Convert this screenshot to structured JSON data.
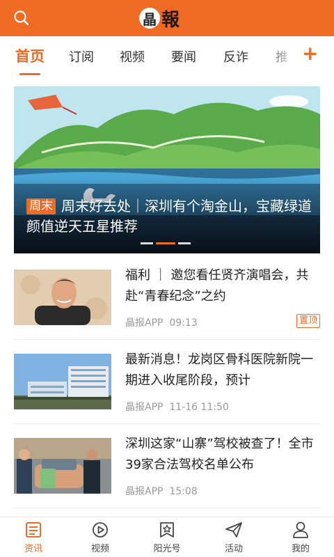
{
  "header": {
    "logo_badge": "晶",
    "logo_rest": "報",
    "search_icon": "search-icon"
  },
  "tabs": [
    {
      "label": "首页",
      "active": true
    },
    {
      "label": "订阅"
    },
    {
      "label": "视频"
    },
    {
      "label": "要闻"
    },
    {
      "label": "反诈"
    },
    {
      "label": "推"
    }
  ],
  "add_tab_label": "+",
  "banner": {
    "tag": "周末",
    "title": "周末好去处｜深圳有个淘金山，宝藏绿道颜值逆天五星推荐",
    "dots": 3,
    "active_dot": 1
  },
  "news": [
    {
      "title": "福利 ｜ 邀您看任贤齐演唱会，共赴“青春纪念”之约",
      "source": "晶报APP",
      "time": "09:13",
      "badge": "置顶"
    },
    {
      "title": "最新消息！龙岗区骨科医院新院一期进入收尾阶段，预计",
      "source": "晶报APP",
      "time": "11-16 11:50"
    },
    {
      "title": "深圳这家“山寨”驾校被查了！全市39家合法驾校名单公布",
      "source": "晶报APP",
      "time": "15:08"
    }
  ],
  "bottom_nav": [
    {
      "label": "资讯",
      "icon": "news-icon",
      "active": true
    },
    {
      "label": "视频",
      "icon": "play-icon"
    },
    {
      "label": "阳光号",
      "icon": "star-badge-icon"
    },
    {
      "label": "活动",
      "icon": "paper-plane-icon"
    },
    {
      "label": "我的",
      "icon": "user-icon"
    }
  ],
  "colors": {
    "accent": "#ef6a22"
  }
}
